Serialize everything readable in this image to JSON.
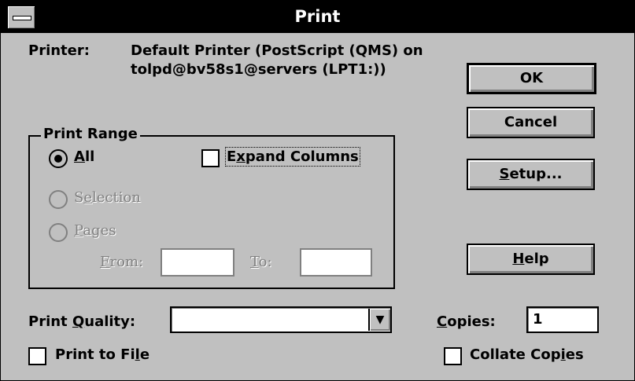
{
  "dialog": {
    "title": "Print"
  },
  "printer": {
    "label": "Printer:",
    "line1": "Default Printer (PostScript (QMS) on",
    "line2": "tolpd@bv58s1@servers (LPT1:))"
  },
  "buttons": {
    "ok": "OK",
    "cancel": "Cancel",
    "setup_pre": "",
    "setup_u": "S",
    "setup_post": "etup...",
    "help_pre": "",
    "help_u": "H",
    "help_post": "elp"
  },
  "print_range": {
    "title": "Print Range",
    "all": {
      "pre": "",
      "u": "A",
      "post": "ll",
      "selected": true
    },
    "selection": {
      "pre": "S",
      "u": "e",
      "post": "lection",
      "enabled": false
    },
    "pages": {
      "pre": "",
      "u": "P",
      "post": "ages",
      "enabled": false
    },
    "from": {
      "pre": "",
      "u": "F",
      "post": "rom:",
      "value": ""
    },
    "to": {
      "pre": "",
      "u": "T",
      "post": "o:",
      "value": ""
    },
    "expand_columns": {
      "pre": "E",
      "u": "x",
      "post": "pand Columns",
      "checked": false
    }
  },
  "print_quality": {
    "pre": "Print ",
    "u": "Q",
    "post": "uality:",
    "value": ""
  },
  "copies": {
    "pre": "",
    "u": "C",
    "post": "opies:",
    "value": "1"
  },
  "print_to_file": {
    "pre": "Print to Fi",
    "u": "l",
    "post": "e",
    "checked": false
  },
  "collate_copies": {
    "pre": "Collate Cop",
    "u": "i",
    "post": "es",
    "checked": false
  },
  "icons": {
    "sysmenu": "system-menu-icon",
    "dropdown": "down-arrow-icon"
  }
}
